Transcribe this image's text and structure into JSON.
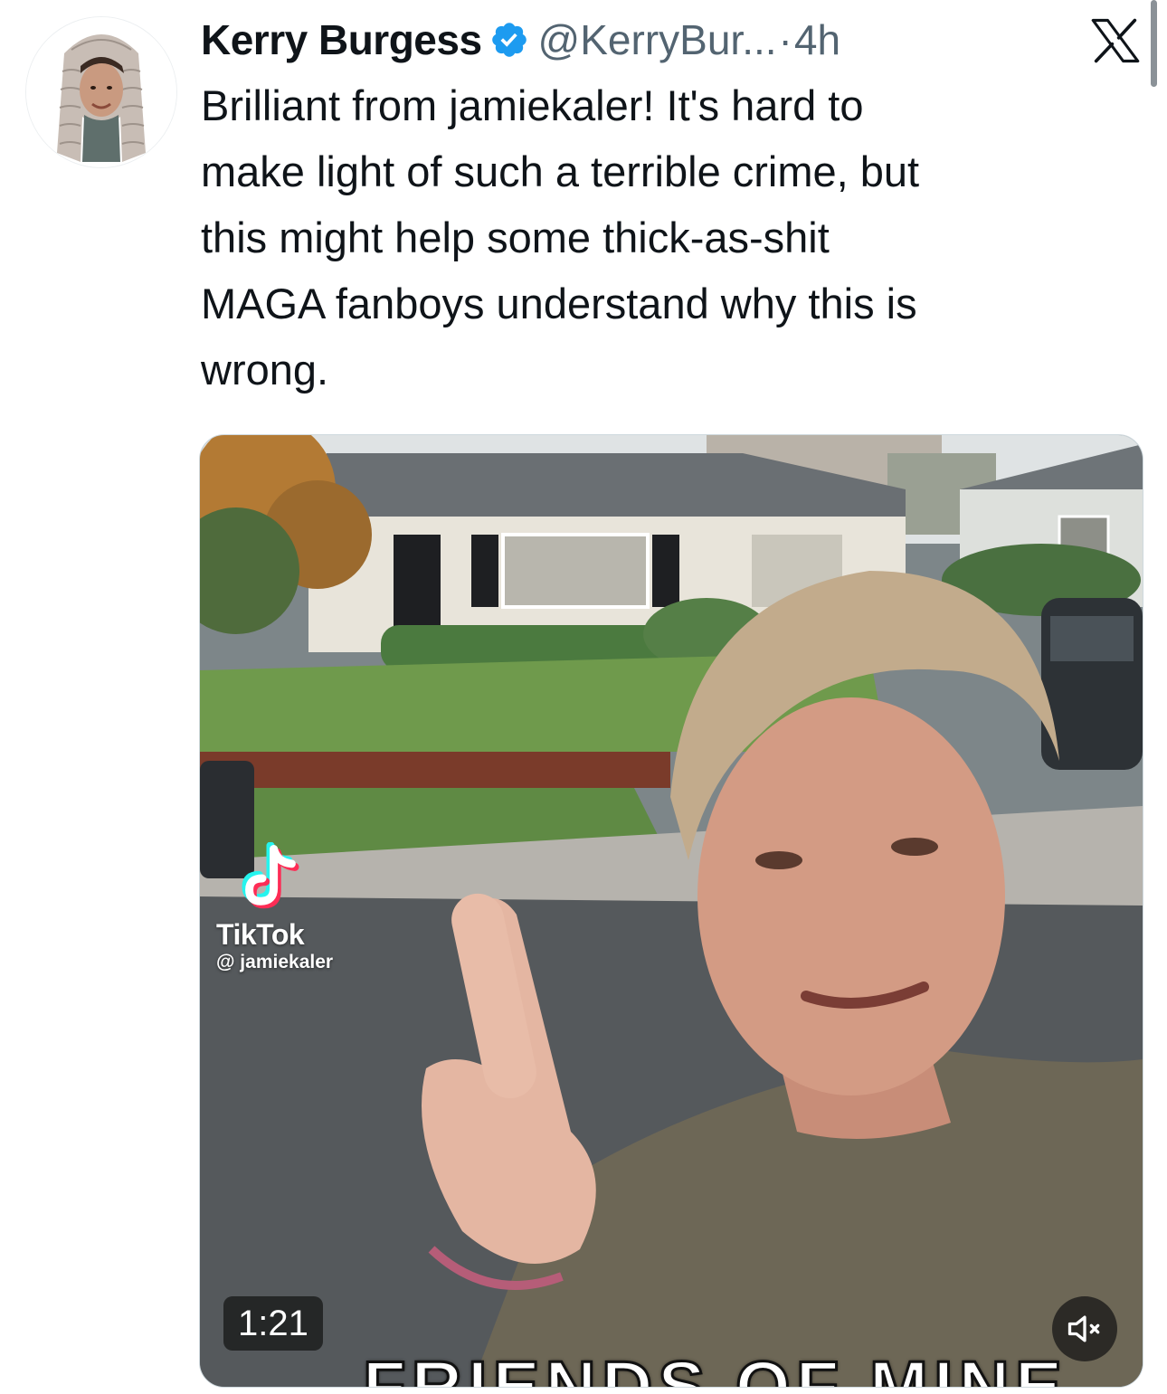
{
  "tweet": {
    "author_name": "Kerry Burgess",
    "handle": "@KerryBur...",
    "separator": "·",
    "time": "4h",
    "text": "Brilliant from jamiekaler! It's hard to\nmake light of such a terrible crime, but\nthis might help some thick-as-shit\nMAGA fanboys understand why this is\nwrong.",
    "verified_color": "#1d9bf0",
    "avatar_icon": "avatar-photo",
    "close_icon": "x-logo-icon"
  },
  "media": {
    "watermark_name": "TikTok",
    "watermark_handle": "@ jamiekaler",
    "duration": "1:21",
    "caption": "FRIENDS OF MINE",
    "mute_icon": "muted-speaker-icon"
  },
  "colors": {
    "text": "#0f1419",
    "secondary_text": "#536471",
    "verified": "#1d9bf0"
  }
}
